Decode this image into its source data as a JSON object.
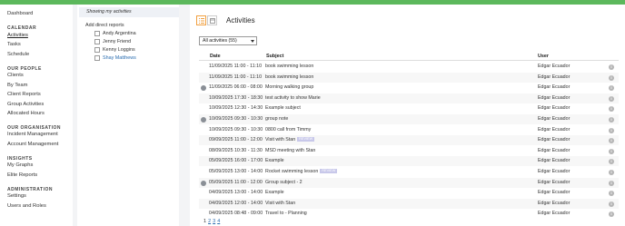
{
  "sidebar": {
    "dashboard": "Dashboard",
    "calendar_heading": "CALENDAR",
    "activities": "Activities",
    "tasks": "Tasks",
    "schedule": "Schedule",
    "our_people_heading": "OUR PEOPLE",
    "clients": "Clients",
    "by_team": "By Team",
    "client_reports": "Client Reports",
    "group_activities": "Group Activities",
    "allocated_hours": "Allocated Hours",
    "our_org_heading": "OUR ORGANISATION",
    "incident_management": "Incident Management",
    "account_management": "Account Management",
    "insights_heading": "INSIGHTS",
    "my_graphs": "My Graphs",
    "elite_reports": "Elite Reports",
    "admin_heading": "ADMINISTRATION",
    "settings": "Settings",
    "users_roles": "Users and Roles"
  },
  "filter": {
    "header": "Showing my activities",
    "label": "Add direct reports",
    "people": [
      "Andy Argentina",
      "Jenny Friend",
      "Kenny Loggins",
      "Shay Matthews"
    ]
  },
  "main": {
    "title": "Activities",
    "select_value": "All activities (55)",
    "columns": {
      "date": "Date",
      "subject": "Subject",
      "user": "User"
    },
    "rows": [
      {
        "date": "11/09/2025 11:00 - 11:10",
        "subject": "book swimming lesson",
        "user": "Edgar Ecuador",
        "avatar": false,
        "badge": ""
      },
      {
        "date": "11/09/2025 11:00 - 11:10",
        "subject": "book swimming lesson",
        "user": "Edgar Ecuador",
        "avatar": false,
        "badge": ""
      },
      {
        "date": "11/09/2025 06:00 - 08:00",
        "subject": "Morning walking group",
        "user": "Edgar Ecuador",
        "avatar": true,
        "badge": ""
      },
      {
        "date": "10/09/2025 17:30 - 18:30",
        "subject": "test activity to show Marie",
        "user": "Edgar Ecuador",
        "avatar": false,
        "badge": ""
      },
      {
        "date": "10/09/2025 12:30 - 14:30",
        "subject": "Example subject",
        "user": "Edgar Ecuador",
        "avatar": false,
        "badge": ""
      },
      {
        "date": "10/09/2025 09:30 - 10:30",
        "subject": "group note",
        "user": "Edgar Ecuador",
        "avatar": true,
        "badge": ""
      },
      {
        "date": "10/09/2025 09:30 - 10:30",
        "subject": "0800 call from Timmy",
        "user": "Edgar Ecuador",
        "avatar": false,
        "badge": ""
      },
      {
        "date": "09/09/2025 11:00 - 12:00",
        "subject": "Visit with Stan",
        "user": "Edgar Ecuador",
        "avatar": false,
        "badge": "REVIEW"
      },
      {
        "date": "08/09/2025 10:30 - 11:30",
        "subject": "MSD meeting with Stan",
        "user": "Edgar Ecuador",
        "avatar": false,
        "badge": ""
      },
      {
        "date": "05/09/2025 16:00 - 17:00",
        "subject": "Example",
        "user": "Edgar Ecuador",
        "avatar": false,
        "badge": ""
      },
      {
        "date": "05/09/2025 13:00 - 14:00",
        "subject": "Rocket swimming lesson",
        "user": "Edgar Ecuador",
        "avatar": false,
        "badge": "REVIEW"
      },
      {
        "date": "05/09/2025 11:00 - 12:00",
        "subject": "Group subject - 2",
        "user": "Edgar Ecuador",
        "avatar": true,
        "badge": ""
      },
      {
        "date": "04/09/2025 13:00 - 14:00",
        "subject": "Example",
        "user": "Edgar Ecuador",
        "avatar": false,
        "badge": ""
      },
      {
        "date": "04/09/2025 12:00 - 14:00",
        "subject": "Visit with Stan",
        "user": "Edgar Ecuador",
        "avatar": false,
        "badge": ""
      },
      {
        "date": "04/09/2025 08:48 - 09:00",
        "subject": "Travel to - Planning",
        "user": "Edgar Ecuador",
        "avatar": false,
        "badge": ""
      }
    ],
    "pages": [
      "1",
      "2",
      "3",
      "4"
    ],
    "current_page": "1"
  }
}
